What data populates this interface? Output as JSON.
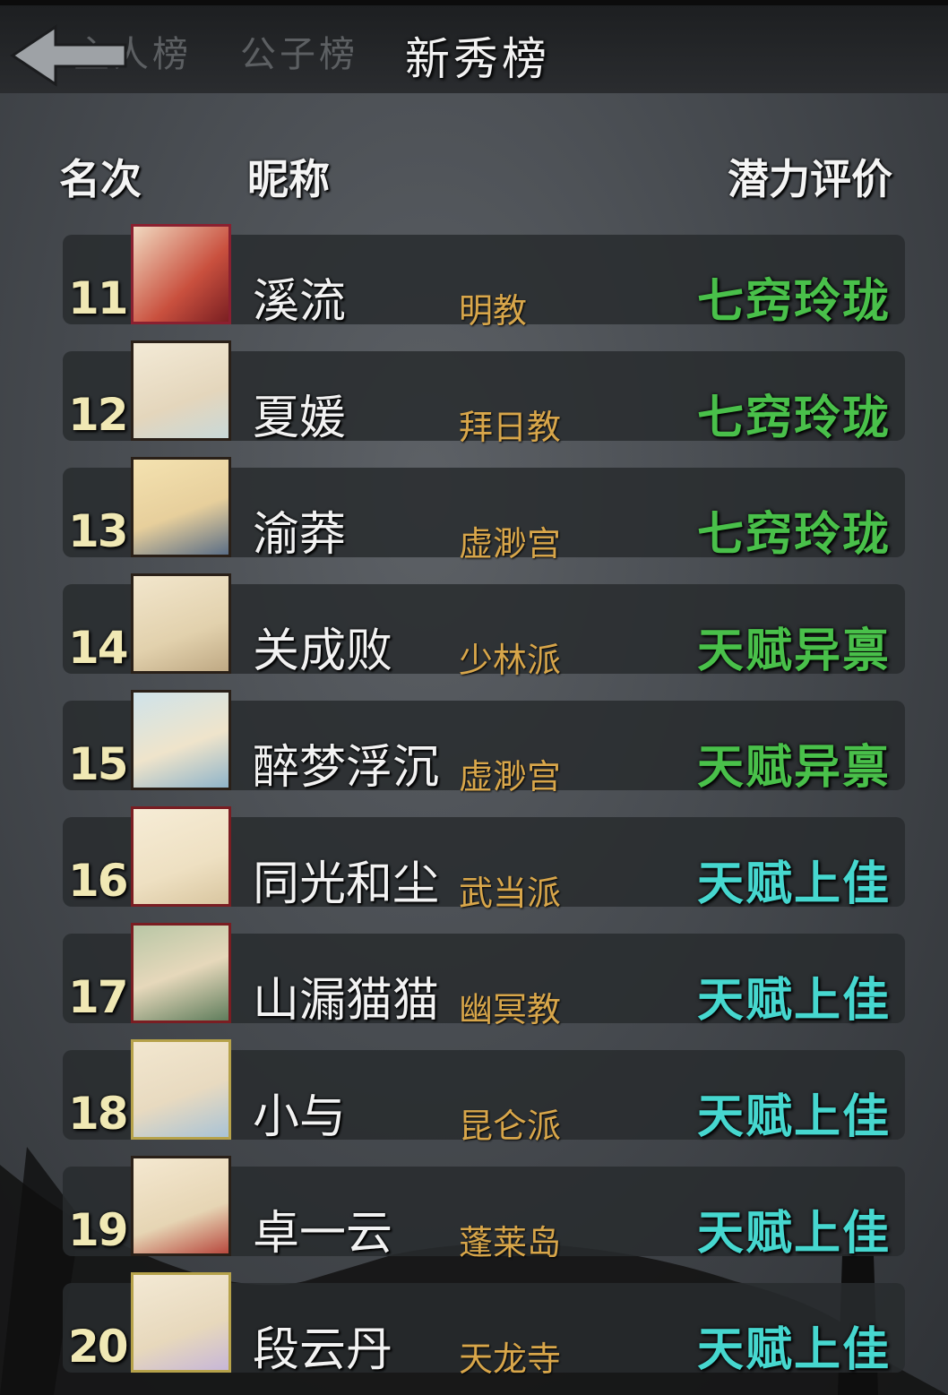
{
  "tabs": [
    {
      "label": "主人榜",
      "state": "partial"
    },
    {
      "label": "公子榜",
      "state": "inactive"
    },
    {
      "label": "新秀榜",
      "state": "active"
    }
  ],
  "columns": {
    "rank": "名次",
    "nickname": "昵称",
    "potential": "潜力评价"
  },
  "colors": {
    "sect": "#d8a64a",
    "rating_green": "#49c04a",
    "rating_cyan": "#46d7cf"
  },
  "rows": [
    {
      "rank": "11",
      "name": "溪流",
      "sect": "明教",
      "rating": "七窍玲珑",
      "rating_color": "#49c04a",
      "avatar": "red-robed-figure-portrait"
    },
    {
      "rank": "12",
      "name": "夏媛",
      "sect": "拜日教",
      "rating": "七窍玲珑",
      "rating_color": "#49c04a",
      "avatar": "woman-with-hairpin-portrait"
    },
    {
      "rank": "13",
      "name": "渝莽",
      "sect": "虚渺宫",
      "rating": "七窍玲珑",
      "rating_color": "#49c04a",
      "avatar": "bearded-scholar-portrait"
    },
    {
      "rank": "14",
      "name": "关成败",
      "sect": "少林派",
      "rating": "天赋异禀",
      "rating_color": "#49c04a",
      "avatar": "stern-warrior-portrait"
    },
    {
      "rank": "15",
      "name": "醉梦浮沉",
      "sect": "虚渺宫",
      "rating": "天赋异禀",
      "rating_color": "#49c04a",
      "avatar": "maiden-in-blue-portrait"
    },
    {
      "rank": "16",
      "name": "同光和尘",
      "sect": "武当派",
      "rating": "天赋上佳",
      "rating_color": "#46d7cf",
      "avatar": "long-haired-sage-portrait"
    },
    {
      "rank": "17",
      "name": "山漏猫猫",
      "sect": "幽冥教",
      "rating": "天赋上佳",
      "rating_color": "#46d7cf",
      "avatar": "flute-player-portrait"
    },
    {
      "rank": "18",
      "name": "小与",
      "sect": "昆仑派",
      "rating": "天赋上佳",
      "rating_color": "#46d7cf",
      "avatar": "young-swordsman-portrait"
    },
    {
      "rank": "19",
      "name": "卓一云",
      "sect": "蓬莱岛",
      "rating": "天赋上佳",
      "rating_color": "#46d7cf",
      "avatar": "long-haired-man-portrait"
    },
    {
      "rank": "20",
      "name": "段云丹",
      "sect": "天龙寺",
      "rating": "天赋上佳",
      "rating_color": "#46d7cf",
      "avatar": "girl-with-hair-ornament-portrait"
    }
  ]
}
